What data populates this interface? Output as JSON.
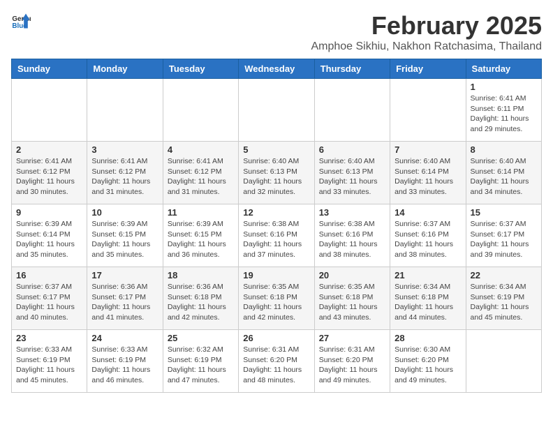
{
  "header": {
    "logo_general": "General",
    "logo_blue": "Blue",
    "title": "February 2025",
    "subtitle": "Amphoe Sikhiu, Nakhon Ratchasima, Thailand"
  },
  "weekdays": [
    "Sunday",
    "Monday",
    "Tuesday",
    "Wednesday",
    "Thursday",
    "Friday",
    "Saturday"
  ],
  "days": {
    "d1": {
      "num": "1",
      "rise": "6:41 AM",
      "set": "6:11 PM",
      "daylight": "11 hours and 29 minutes."
    },
    "d2": {
      "num": "2",
      "rise": "6:41 AM",
      "set": "6:12 PM",
      "daylight": "11 hours and 30 minutes."
    },
    "d3": {
      "num": "3",
      "rise": "6:41 AM",
      "set": "6:12 PM",
      "daylight": "11 hours and 31 minutes."
    },
    "d4": {
      "num": "4",
      "rise": "6:41 AM",
      "set": "6:12 PM",
      "daylight": "11 hours and 31 minutes."
    },
    "d5": {
      "num": "5",
      "rise": "6:40 AM",
      "set": "6:13 PM",
      "daylight": "11 hours and 32 minutes."
    },
    "d6": {
      "num": "6",
      "rise": "6:40 AM",
      "set": "6:13 PM",
      "daylight": "11 hours and 33 minutes."
    },
    "d7": {
      "num": "7",
      "rise": "6:40 AM",
      "set": "6:14 PM",
      "daylight": "11 hours and 33 minutes."
    },
    "d8": {
      "num": "8",
      "rise": "6:40 AM",
      "set": "6:14 PM",
      "daylight": "11 hours and 34 minutes."
    },
    "d9": {
      "num": "9",
      "rise": "6:39 AM",
      "set": "6:14 PM",
      "daylight": "11 hours and 35 minutes."
    },
    "d10": {
      "num": "10",
      "rise": "6:39 AM",
      "set": "6:15 PM",
      "daylight": "11 hours and 35 minutes."
    },
    "d11": {
      "num": "11",
      "rise": "6:39 AM",
      "set": "6:15 PM",
      "daylight": "11 hours and 36 minutes."
    },
    "d12": {
      "num": "12",
      "rise": "6:38 AM",
      "set": "6:16 PM",
      "daylight": "11 hours and 37 minutes."
    },
    "d13": {
      "num": "13",
      "rise": "6:38 AM",
      "set": "6:16 PM",
      "daylight": "11 hours and 38 minutes."
    },
    "d14": {
      "num": "14",
      "rise": "6:37 AM",
      "set": "6:16 PM",
      "daylight": "11 hours and 38 minutes."
    },
    "d15": {
      "num": "15",
      "rise": "6:37 AM",
      "set": "6:17 PM",
      "daylight": "11 hours and 39 minutes."
    },
    "d16": {
      "num": "16",
      "rise": "6:37 AM",
      "set": "6:17 PM",
      "daylight": "11 hours and 40 minutes."
    },
    "d17": {
      "num": "17",
      "rise": "6:36 AM",
      "set": "6:17 PM",
      "daylight": "11 hours and 41 minutes."
    },
    "d18": {
      "num": "18",
      "rise": "6:36 AM",
      "set": "6:18 PM",
      "daylight": "11 hours and 42 minutes."
    },
    "d19": {
      "num": "19",
      "rise": "6:35 AM",
      "set": "6:18 PM",
      "daylight": "11 hours and 42 minutes."
    },
    "d20": {
      "num": "20",
      "rise": "6:35 AM",
      "set": "6:18 PM",
      "daylight": "11 hours and 43 minutes."
    },
    "d21": {
      "num": "21",
      "rise": "6:34 AM",
      "set": "6:18 PM",
      "daylight": "11 hours and 44 minutes."
    },
    "d22": {
      "num": "22",
      "rise": "6:34 AM",
      "set": "6:19 PM",
      "daylight": "11 hours and 45 minutes."
    },
    "d23": {
      "num": "23",
      "rise": "6:33 AM",
      "set": "6:19 PM",
      "daylight": "11 hours and 45 minutes."
    },
    "d24": {
      "num": "24",
      "rise": "6:33 AM",
      "set": "6:19 PM",
      "daylight": "11 hours and 46 minutes."
    },
    "d25": {
      "num": "25",
      "rise": "6:32 AM",
      "set": "6:19 PM",
      "daylight": "11 hours and 47 minutes."
    },
    "d26": {
      "num": "26",
      "rise": "6:31 AM",
      "set": "6:20 PM",
      "daylight": "11 hours and 48 minutes."
    },
    "d27": {
      "num": "27",
      "rise": "6:31 AM",
      "set": "6:20 PM",
      "daylight": "11 hours and 49 minutes."
    },
    "d28": {
      "num": "28",
      "rise": "6:30 AM",
      "set": "6:20 PM",
      "daylight": "11 hours and 49 minutes."
    }
  }
}
